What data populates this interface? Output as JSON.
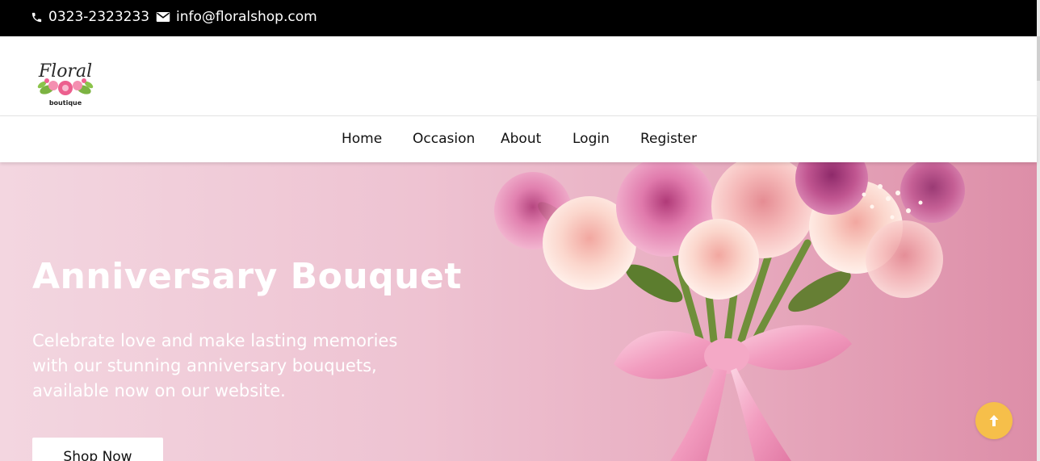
{
  "topbar": {
    "phone": "0323-2323233",
    "email": "info@floralshop.com",
    "phone_icon": "phone-icon",
    "email_icon": "envelope-icon"
  },
  "logo": {
    "script": "Floral",
    "sub": "boutique"
  },
  "nav": {
    "items": [
      "Home",
      "Occasion",
      "About",
      "Login",
      "Register"
    ]
  },
  "hero": {
    "title": "Anniversary Bouquet",
    "text": "Celebrate love and make lasting memories with our stunning anniversary bouquets, available now on our website.",
    "button": "Shop Now"
  },
  "scroll_top": {
    "icon": "arrow-up-icon",
    "color": "#f6bf4a"
  }
}
